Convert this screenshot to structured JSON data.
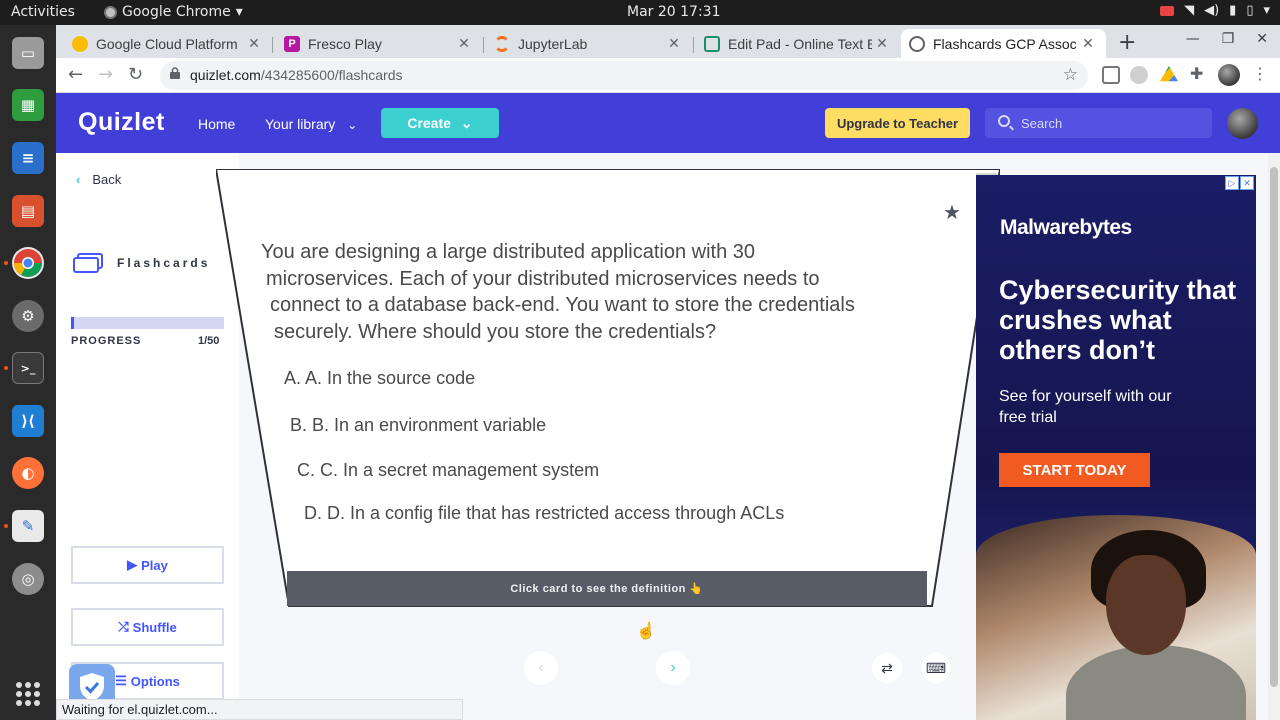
{
  "system": {
    "activities": "Activities",
    "app_name": "Google Chrome",
    "clock": "Mar 20  17:31"
  },
  "dock": {
    "apps": [
      "files",
      "spreadsheet",
      "document",
      "presentation",
      "chrome",
      "settings",
      "terminal",
      "vscode",
      "firefox",
      "text-editor",
      "disks"
    ]
  },
  "browser": {
    "tabs": [
      {
        "label": "Google Cloud Platform",
        "favicon": "gcp-icon",
        "color": "#fbbc04"
      },
      {
        "label": "Fresco Play",
        "favicon": "fresco-icon",
        "color": "#b5179e"
      },
      {
        "label": "JupyterLab",
        "favicon": "jupyter-icon",
        "color": "#f37626"
      },
      {
        "label": "Edit Pad - Online Text E",
        "favicon": "editpad-icon",
        "color": "#1a8f6a"
      },
      {
        "label": "Flashcards GCP Assoc E",
        "favicon": "globe-icon",
        "color": "#5f6368"
      }
    ],
    "url_host": "quizlet.com",
    "url_path": "/434285600/flashcards",
    "status_text": "Waiting for el.quizlet.com..."
  },
  "quizlet": {
    "logo": "Quizlet",
    "nav_home": "Home",
    "nav_library": "Your library",
    "create": "Create",
    "upgrade": "Upgrade to Teacher",
    "search_placeholder": "Search",
    "back": "Back",
    "mode": "Flashcards",
    "progress_label": "PROGRESS",
    "progress_count": "1/50",
    "progress_fraction": 0.02,
    "play": "Play",
    "shuffle": "Shuffle",
    "options": "Options",
    "card_footer": "Click card to see the definition 👆",
    "question_lines": [
      "You are designing a large distributed application with 30",
      "microservices. Each of your distributed microservices needs to",
      "connect to a database back-end. You want to store the credentials",
      "securely. Where should you store the credentials?"
    ],
    "options_list": [
      "A. A. In the source code",
      "B. B. In an environment variable",
      "C. C. In a secret management system",
      "D. D. In a config file that has restricted access through ACLs"
    ],
    "colors": {
      "brand": "#4255ff",
      "teal": "#3ccfcf",
      "yellow": "#ffdc62"
    }
  },
  "ad": {
    "brand": "Malwarebytes",
    "headline": "Cybersecurity that crushes what others don’t",
    "sub": "See for yourself with our free trial",
    "cta": "START TODAY"
  }
}
